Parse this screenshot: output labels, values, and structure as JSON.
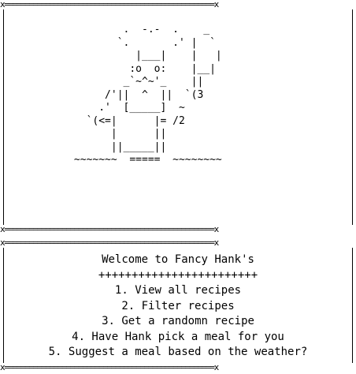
{
  "frame": {
    "top_rule": "x===================================================x",
    "middle_rule_1": "x===================================================x",
    "middle_rule_2": "x===================================================x",
    "bottom_rule": "x===================================================x"
  },
  "art": {
    "lines": [
      "                    .  -.-  .    _",
      "                   `.       .' |  `",
      "                      |___|    |   |",
      "                     :o  o:    |__|",
      "                    _`~^~'_    ||",
      "                 /'||  ^  ||  `(3",
      "                .'  [_____]  ~",
      "              `(<=|      |= /2",
      "                  |      ||",
      "                  ||_____||",
      "            ~~~~~~~  =====  ~~~~~~~~"
    ]
  },
  "menu": {
    "welcome": "Welcome to Fancy Hank's",
    "divider": "++++++++++++++++++++++++",
    "options": [
      "1. View all recipes",
      "2. Filter recipes",
      "3. Get a randomn recipe",
      "4. Have Hank pick a meal for you",
      "5. Suggest a meal based on the weather?"
    ]
  }
}
